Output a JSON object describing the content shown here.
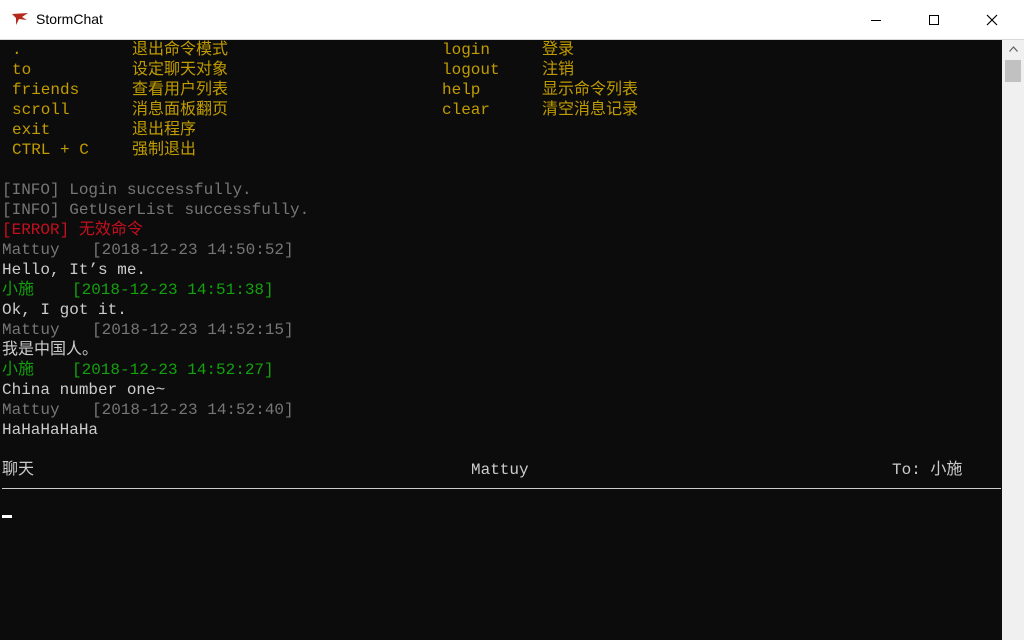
{
  "window": {
    "title": "StormChat"
  },
  "help_left": [
    {
      "cmd": ".",
      "desc": "退出命令模式"
    },
    {
      "cmd": "to",
      "desc": "设定聊天对象"
    },
    {
      "cmd": "friends",
      "desc": "查看用户列表"
    },
    {
      "cmd": "scroll",
      "desc": "消息面板翻页"
    },
    {
      "cmd": "exit",
      "desc": "退出程序"
    },
    {
      "cmd": "CTRL + C",
      "desc": "强制退出"
    }
  ],
  "help_right": [
    {
      "cmd": "login",
      "desc": "登录"
    },
    {
      "cmd": "logout",
      "desc": "注销"
    },
    {
      "cmd": "help",
      "desc": "显示命令列表"
    },
    {
      "cmd": "clear",
      "desc": "清空消息记录"
    }
  ],
  "log": [
    {
      "tag": "[INFO]",
      "text": "Login successfully."
    },
    {
      "tag": "[INFO]",
      "text": "GetUserList successfully."
    },
    {
      "tag": "[ERROR]",
      "text": "无效命令"
    }
  ],
  "messages": [
    {
      "sender": "Mattuy",
      "time": "[2018-12-23 14:50:52]",
      "text": "Hello, It’s me."
    },
    {
      "sender": "小施",
      "time": "[2018-12-23 14:51:38]",
      "text": "Ok, I got it."
    },
    {
      "sender": "Mattuy",
      "time": "[2018-12-23 14:52:15]",
      "text": "我是中国人。"
    },
    {
      "sender": "小施",
      "time": "[2018-12-23 14:52:27]",
      "text": "China number one~"
    },
    {
      "sender": "Mattuy",
      "time": "[2018-12-23 14:52:40]",
      "text": "HaHaHaHaHa"
    }
  ],
  "status": {
    "mode": "聊天",
    "user": "Mattuy",
    "target": "To: 小施"
  },
  "colors": {
    "help": "#c19c00",
    "info": "#767676",
    "error": "#c50f1f",
    "self": "#767676",
    "other": "#13a10e",
    "text": "#cccccc"
  }
}
